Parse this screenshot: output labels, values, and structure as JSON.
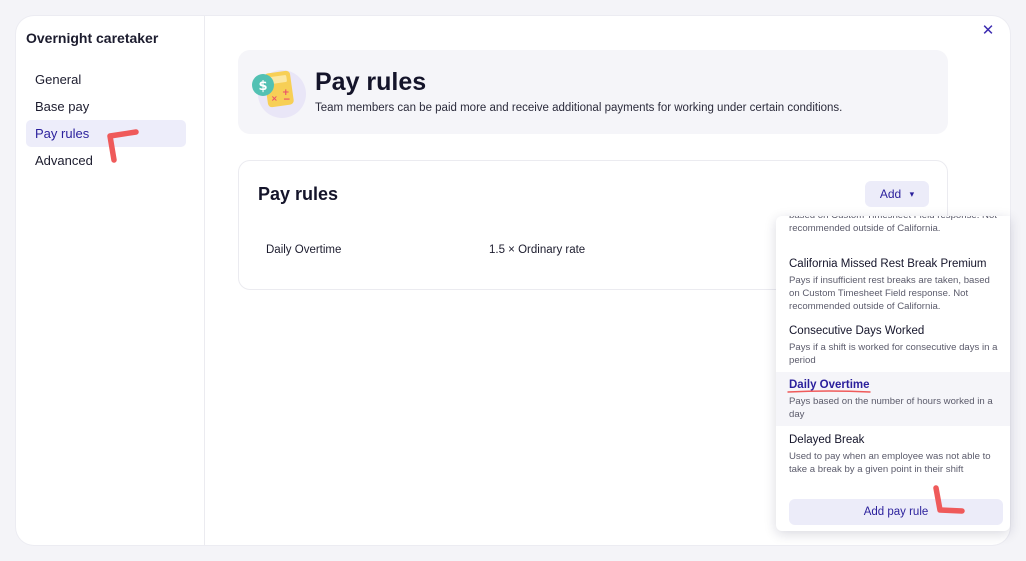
{
  "sidebar": {
    "title": "Overnight caretaker",
    "items": [
      {
        "label": "General",
        "active": false
      },
      {
        "label": "Base pay",
        "active": false
      },
      {
        "label": "Pay rules",
        "active": true
      },
      {
        "label": "Advanced",
        "active": false
      }
    ]
  },
  "close_icon": "close-icon",
  "header": {
    "title": "Pay rules",
    "description": "Team members can be paid more and receive additional payments for working under certain conditions.",
    "illustration_symbol": "$"
  },
  "rules_card": {
    "title": "Pay rules",
    "add_label": "Add",
    "rows": [
      {
        "name": "Daily Overtime",
        "rate": "1.5 × Ordinary rate"
      }
    ]
  },
  "dropdown": {
    "cut_off_text": "based on Custom Timesheet Field response. Not recommended outside of California.",
    "options": [
      {
        "title": "California Missed Rest Break Premium",
        "description": "Pays if insufficient rest breaks are taken, based on Custom Timesheet Field response. Not recommended outside of California."
      },
      {
        "title": "Consecutive Days Worked",
        "description": "Pays if a shift is worked for consecutive days in a period"
      },
      {
        "title": "Daily Overtime",
        "description": "Pays based on the number of hours worked in a day",
        "selected": true
      },
      {
        "title": "Delayed Break",
        "description": "Used to pay when an employee was not able to take a break by a given point in their shift"
      }
    ],
    "add_rule_label": "Add pay rule"
  },
  "colors": {
    "accent": "#2a1f9c",
    "annotation": "#ef5a5a",
    "active_bg": "#ededfa"
  }
}
